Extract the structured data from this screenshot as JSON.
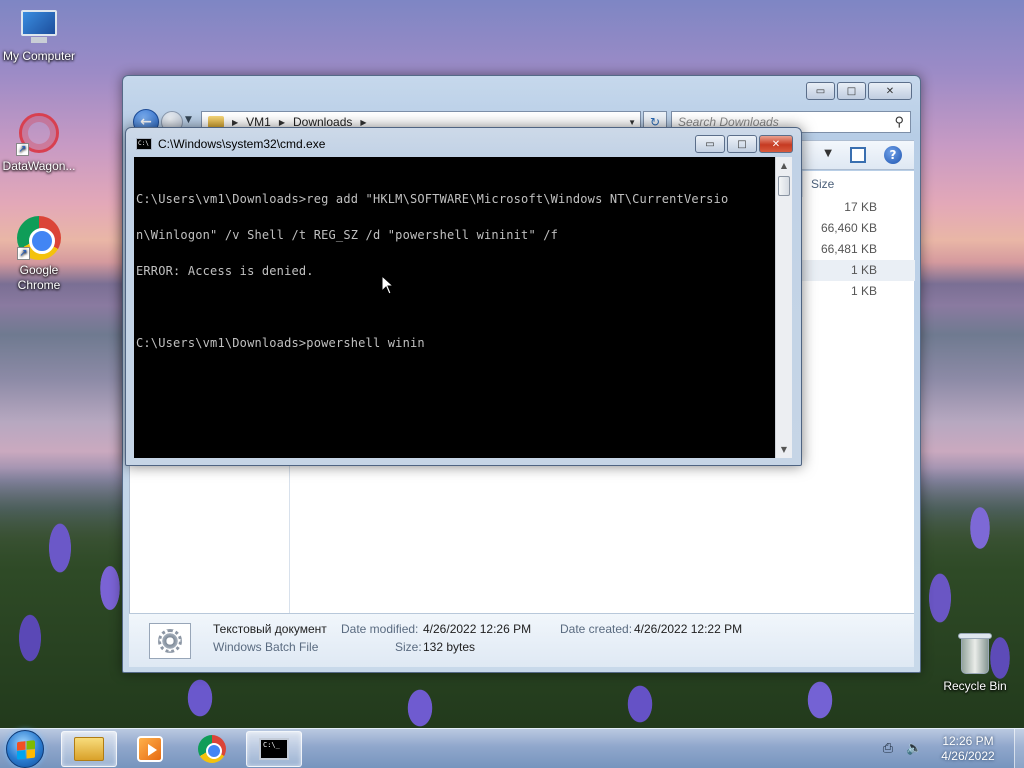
{
  "desktop": {
    "icons": [
      {
        "label": "My Computer"
      },
      {
        "label": "DataWagon..."
      },
      {
        "label": "Google Chrome"
      },
      {
        "label": "Recycle Bin"
      }
    ]
  },
  "explorer": {
    "address": {
      "root": "VM1",
      "folder": "Downloads"
    },
    "search_placeholder": "Search Downloads",
    "size_header": "Size",
    "sizes": [
      "17 KB",
      "66,460 KB",
      "66,481 KB",
      "1 KB",
      "1 KB"
    ],
    "details": {
      "file_name": "Текстовый документ",
      "file_type": "Windows Batch File",
      "date_modified_label": "Date modified:",
      "date_modified": "4/26/2022 12:26 PM",
      "date_created_label": "Date created:",
      "date_created": "4/26/2022 12:22 PM",
      "size_label": "Size:",
      "size": "132 bytes"
    },
    "controls": {
      "minimize": "▭",
      "maximize": "□",
      "close": "✕"
    }
  },
  "cmd": {
    "title": "C:\\Windows\\system32\\cmd.exe",
    "lines": [
      "C:\\Users\\vm1\\Downloads>reg add \"HKLM\\SOFTWARE\\Microsoft\\Windows NT\\CurrentVersio",
      "n\\Winlogon\" /v Shell /t REG_SZ /d \"powershell wininit\" /f",
      "ERROR: Access is denied.",
      "",
      "C:\\Users\\vm1\\Downloads>powershell winin"
    ],
    "controls": {
      "minimize": "▭",
      "maximize": "□",
      "close": "✕"
    }
  },
  "taskbar": {
    "clock_time": "12:26 PM",
    "clock_date": "4/26/2022"
  }
}
